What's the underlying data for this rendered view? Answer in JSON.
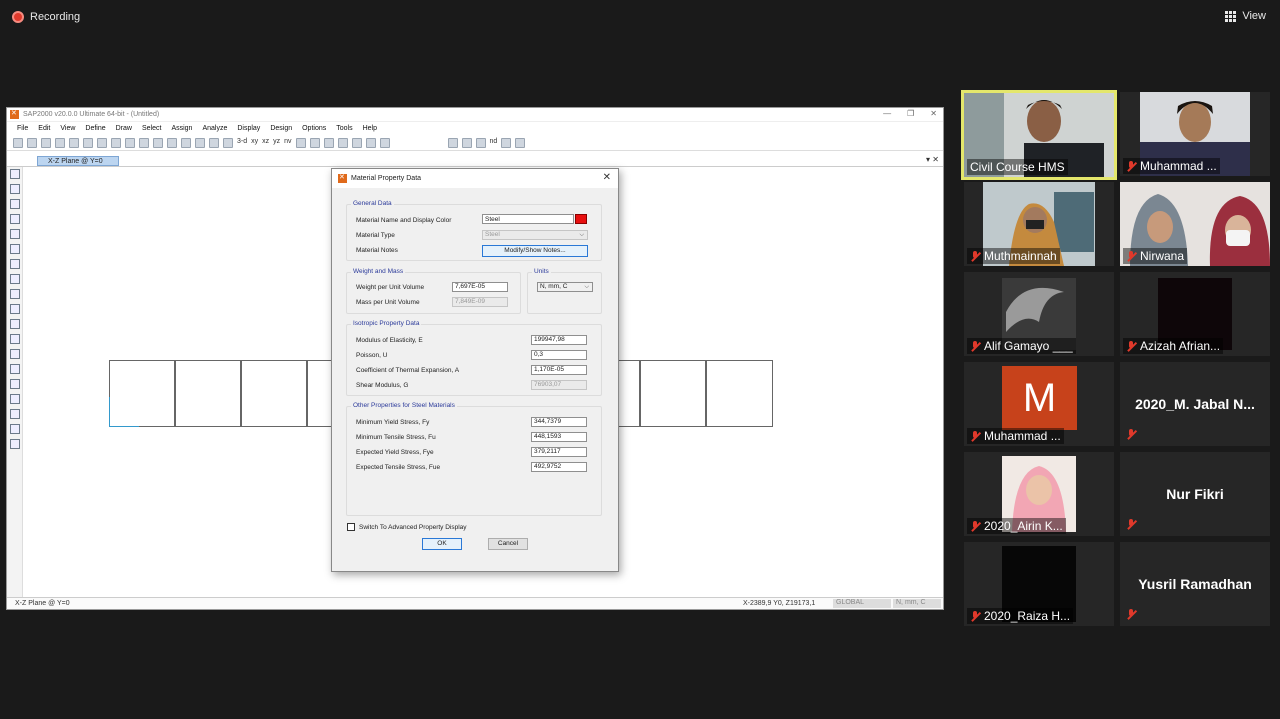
{
  "zoom": {
    "recording_label": "Recording",
    "view_label": "View"
  },
  "sap": {
    "title": "SAP2000 v20.0.0 Ultimate 64-bit - (Untitled)",
    "menu": [
      "File",
      "Edit",
      "View",
      "Define",
      "Draw",
      "Select",
      "Assign",
      "Analyze",
      "Display",
      "Design",
      "Options",
      "Tools",
      "Help"
    ],
    "toolbar_text": [
      "3-d",
      "xy",
      "xz",
      "yz",
      "nv",
      "nd"
    ],
    "tab_label": "X-Z Plane @ Y=0",
    "status_left": "X-Z Plane @ Y=0",
    "status_coords": "X-2389,9  Y0,  Z19173,1",
    "status_global": "GLOBAL",
    "status_units": "N, mm, C"
  },
  "dialog": {
    "title": "Material Property Data",
    "general": {
      "title": "General Data",
      "name_label": "Material Name and Display Color",
      "name_value": "Steel",
      "type_label": "Material Type",
      "type_value": "Steel",
      "notes_label": "Material Notes",
      "notes_button": "Modify/Show Notes..."
    },
    "weight": {
      "title": "Weight and Mass",
      "wpv_label": "Weight per Unit Volume",
      "wpv_value": "7,697E-05",
      "mpv_label": "Mass per Unit Volume",
      "mpv_value": "7,849E-09"
    },
    "units": {
      "title": "Units",
      "value": "N, mm, C"
    },
    "isotropic": {
      "title": "Isotropic Property Data",
      "e_label": "Modulus of Elasticity,  E",
      "e_value": "199947,98",
      "u_label": "Poisson,  U",
      "u_value": "0,3",
      "a_label": "Coefficient of Thermal Expansion,  A",
      "a_value": "1,170E-05",
      "g_label": "Shear Modulus,  G",
      "g_value": "76903,07"
    },
    "steel": {
      "title": "Other Properties for Steel Materials",
      "fy_label": "Minimum Yield Stress, Fy",
      "fy_value": "344,7379",
      "fu_label": "Minimum Tensile Stress, Fu",
      "fu_value": "448,1593",
      "fye_label": "Expected Yield Stress, Fye",
      "fye_value": "379,2117",
      "fue_label": "Expected Tensile Stress, Fue",
      "fue_value": "492,9752"
    },
    "advanced_label": "Switch To Advanced Property Display",
    "ok_label": "OK",
    "cancel_label": "Cancel"
  },
  "participants": [
    {
      "name": "Civil Course HMS",
      "muted": false,
      "active": true
    },
    {
      "name": "Muhammad ...",
      "muted": true
    },
    {
      "name": "Muthmainnah",
      "muted": true
    },
    {
      "name": "Nirwana",
      "muted": true
    },
    {
      "name": "Alif Gamayo ___",
      "muted": true
    },
    {
      "name": "Azizah Afrian...",
      "muted": true
    },
    {
      "name": "Muhammad ...",
      "muted": true,
      "avatar_letter": "M"
    },
    {
      "name": "2020_M. Jabal N...",
      "muted": true
    },
    {
      "name": "2020_Airin K...",
      "muted": true
    },
    {
      "name": "Nur Fikri",
      "muted": true
    },
    {
      "name": "2020_Raiza H...",
      "muted": true
    },
    {
      "name": "Yusril Ramadhan",
      "muted": true
    }
  ],
  "colors": {
    "active_speaker": "#e4e76c",
    "muted_icon": "#e0392b",
    "sap_accent": "#e06a1b"
  }
}
